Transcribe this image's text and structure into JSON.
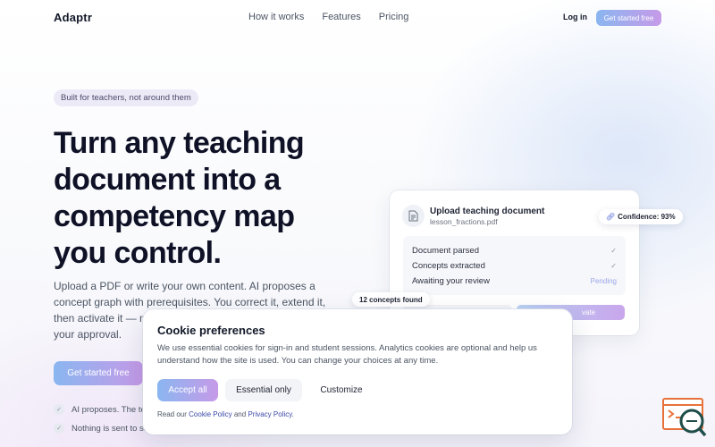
{
  "nav": {
    "logo": "Adaptr",
    "links": [
      "How it works",
      "Features",
      "Pricing"
    ],
    "login": "Log in",
    "cta": "Get started free"
  },
  "hero": {
    "pill": "Built for teachers, not around them",
    "headline": "Turn any teaching document into a competency map you control.",
    "subtext": "Upload a PDF or write your own content. AI proposes a concept graph with prerequisites. You correct it, extend it, then activate it — n",
    "subtext_tail": "your approval.",
    "cta": "Get started free",
    "checks": [
      "AI proposes. The te",
      "Nothing is sent to stu"
    ]
  },
  "card": {
    "title": "Upload teaching document",
    "file": "lesson_fractions.pdf",
    "steps": [
      {
        "label": "Document parsed",
        "state": "✓"
      },
      {
        "label": "Concepts extracted",
        "state": "✓"
      },
      {
        "label": "Awaiting your review",
        "state": "Pending"
      }
    ],
    "activate_label": "vate",
    "confidence": "Confidence: 93%",
    "concepts_found": "12 concepts found"
  },
  "cookie": {
    "title": "Cookie preferences",
    "body": "We use essential cookies for sign-in and student sessions. Analytics cookies are optional and help us understand how the site is used. You can change your choices at any time.",
    "accept": "Accept all",
    "essential": "Essential only",
    "customize": "Customize",
    "foot_prefix": "Read our",
    "cookie_policy": "Cookie Policy",
    "and": "and",
    "privacy_policy": "Privacy Policy",
    "foot_suffix": "."
  },
  "colors": {
    "accent_start": "#8ab6f0",
    "accent_end": "#c69ae8",
    "link": "#3b4aa8",
    "widget_orange": "#e8713a",
    "widget_teal": "#1f4d4a"
  }
}
